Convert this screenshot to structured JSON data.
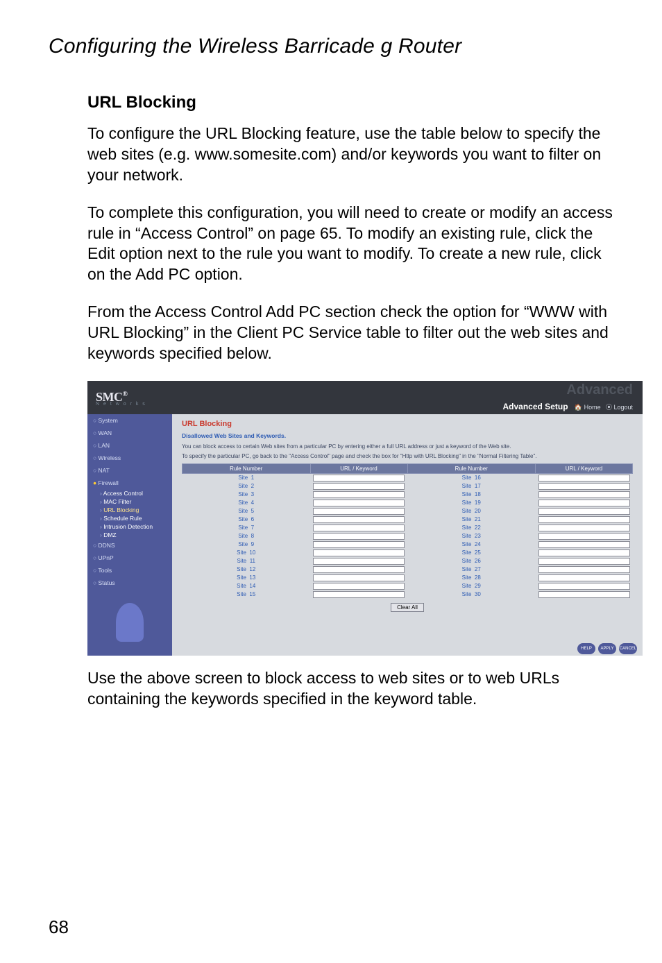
{
  "page_title": "Configuring the Wireless Barricade g Router",
  "heading": "URL Blocking",
  "para1": "To configure the URL Blocking feature, use the table below to specify the web sites (e.g. www.somesite.com) and/or keywords you want to filter on your network.",
  "para2": "To complete this configuration, you will need to create or modify an access rule in “Access Control” on page 65. To modify an existing rule, click the Edit option next to the rule you want to modify. To create a new rule, click on the Add PC option.",
  "para3": "From the Access Control Add PC section check the option for “WWW with URL Blocking” in the Client PC Service table to filter out the web sites and keywords specified below.",
  "para4": "Use the above screen to block access to web sites or to web URLs containing the keywords specified in the keyword table.",
  "page_number": "68",
  "screenshot": {
    "logo": "SMC",
    "networks": "N e t w o r k s",
    "ghost": "Advanced",
    "adv_setup": "Advanced Setup",
    "home": "Home",
    "logout": "Logout",
    "sidebar": {
      "items": [
        "System",
        "WAN",
        "LAN",
        "Wireless",
        "NAT",
        "Firewall"
      ],
      "sub": [
        "Access Control",
        "MAC Filter",
        "URL Blocking",
        "Schedule Rule",
        "Intrusion Detection",
        "DMZ"
      ],
      "items2": [
        "DDNS",
        "UPnP",
        "Tools",
        "Status"
      ]
    },
    "main": {
      "title": "URL Blocking",
      "subtitle": "Disallowed Web Sites and Keywords.",
      "desc1": "You can block access to certain Web sites from a particular PC by entering either a full URL address or just a keyword of the Web site.",
      "desc2": "To specify the particular PC, go back to the \"Access Control\" page and check the box for \"Http with URL Blocking\" in the \"Normal Filtering Table\".",
      "th_rule": "Rule Number",
      "th_url": "URL / Keyword",
      "site_label": "Site",
      "rows_left": [
        "1",
        "2",
        "3",
        "4",
        "5",
        "6",
        "7",
        "8",
        "9",
        "10",
        "11",
        "12",
        "13",
        "14",
        "15"
      ],
      "rows_right": [
        "16",
        "17",
        "18",
        "19",
        "20",
        "21",
        "22",
        "23",
        "24",
        "25",
        "26",
        "27",
        "28",
        "29",
        "30"
      ],
      "clear": "Clear All",
      "help": "HELP",
      "apply": "APPLY",
      "cancel": "CANCEL"
    }
  }
}
